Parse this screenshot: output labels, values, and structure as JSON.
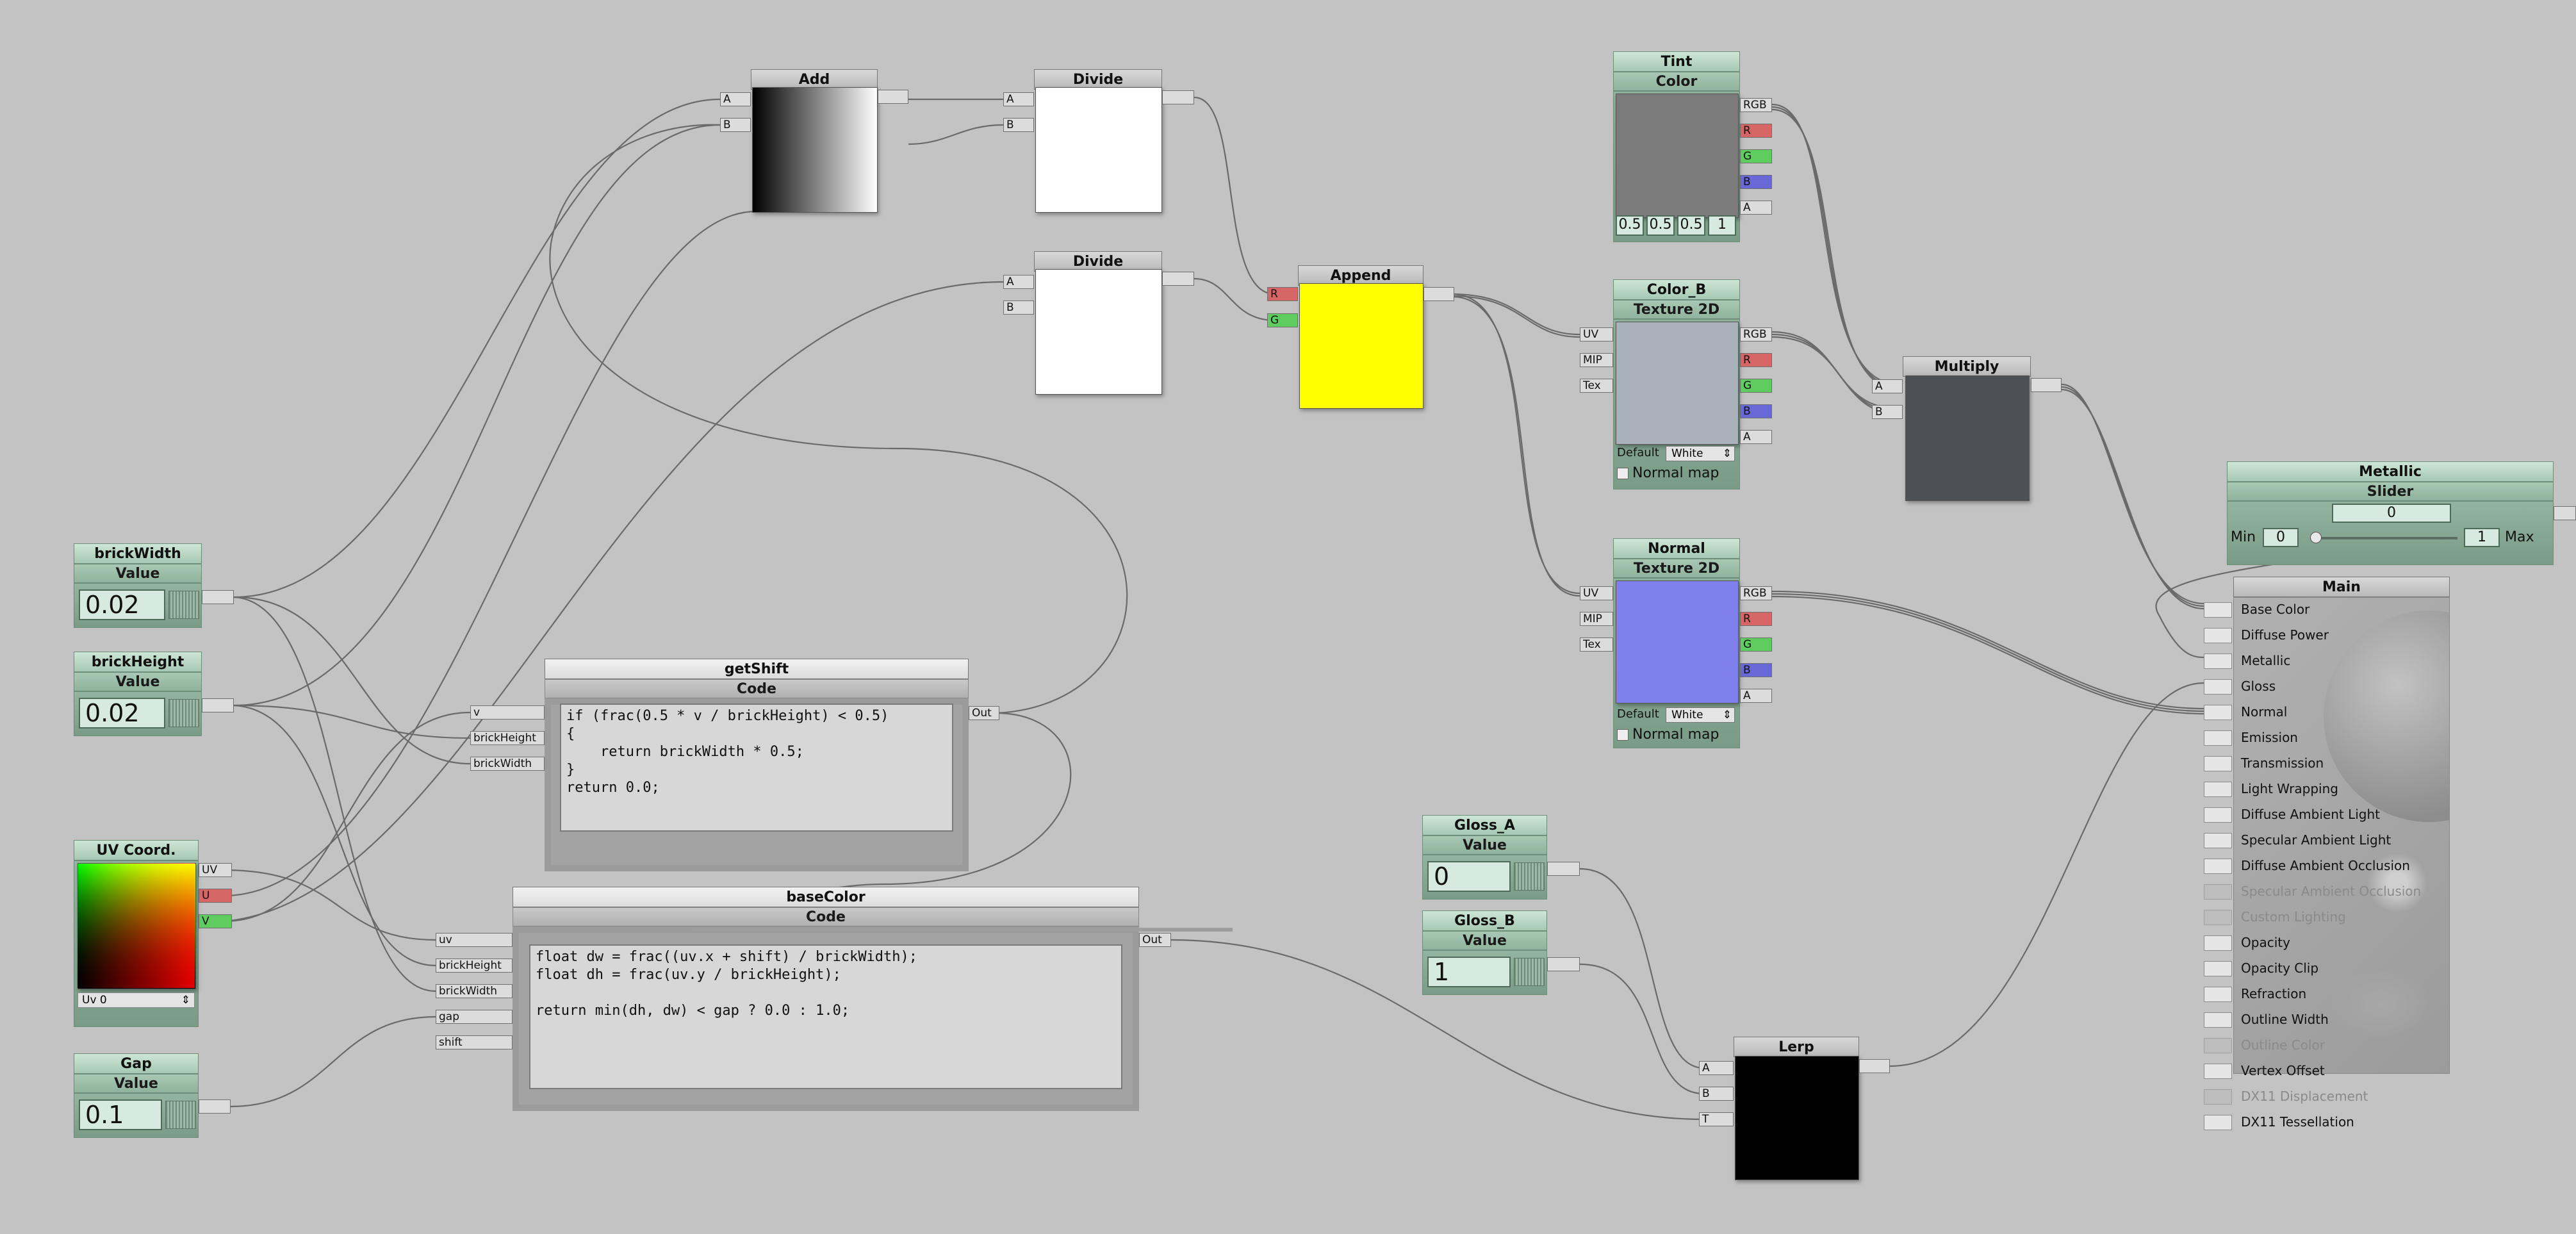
{
  "nodes": {
    "brickWidth": {
      "title": "brickWidth",
      "sub": "Value",
      "value": "0.02"
    },
    "brickHeight": {
      "title": "brickHeight",
      "sub": "Value",
      "value": "0.02"
    },
    "uvcoord": {
      "title": "UV Coord.",
      "outputs": [
        "UV",
        "U",
        "V"
      ],
      "select": "Uv 0"
    },
    "gap": {
      "title": "Gap",
      "sub": "Value",
      "value": "0.1"
    },
    "add": {
      "title": "Add",
      "inputs": [
        "A",
        "B"
      ]
    },
    "divide1": {
      "title": "Divide",
      "inputs": [
        "A",
        "B"
      ]
    },
    "divide2": {
      "title": "Divide",
      "inputs": [
        "A",
        "B"
      ]
    },
    "append": {
      "title": "Append",
      "inputs": [
        "R",
        "G"
      ]
    },
    "getShift": {
      "title": "getShift",
      "sub": "Code",
      "inputs": [
        "v",
        "brickHeight",
        "brickWidth"
      ],
      "output": "Out",
      "code": "if (frac(0.5 * v / brickHeight) < 0.5)\n{\n    return brickWidth * 0.5;\n}\nreturn 0.0;"
    },
    "baseColor": {
      "title": "baseColor",
      "sub": "Code",
      "inputs": [
        "uv",
        "brickHeight",
        "brickWidth",
        "gap",
        "shift"
      ],
      "output": "Out",
      "code": "float dw = frac((uv.x + shift) / brickWidth);\nfloat dh = frac(uv.y / brickHeight);\n\nreturn min(dh, dw) < gap ? 0.0 : 1.0;"
    },
    "tint": {
      "title": "Tint",
      "sub": "Color",
      "outputs": [
        "RGB",
        "R",
        "G",
        "B",
        "A"
      ],
      "values": [
        "0.5",
        "0.5",
        "0.5",
        "1"
      ]
    },
    "colorB": {
      "title": "Color_B",
      "sub": "Texture 2D",
      "inputs": [
        "UV",
        "MIP",
        "Tex"
      ],
      "outputs": [
        "RGB",
        "R",
        "G",
        "B",
        "A"
      ],
      "default_label": "Default",
      "default_value": "White",
      "normal_map": "Normal map"
    },
    "normal": {
      "title": "Normal",
      "sub": "Texture 2D",
      "inputs": [
        "UV",
        "MIP",
        "Tex"
      ],
      "outputs": [
        "RGB",
        "R",
        "G",
        "B",
        "A"
      ],
      "default_label": "Default",
      "default_value": "White",
      "normal_map": "Normal map"
    },
    "multiply": {
      "title": "Multiply",
      "inputs": [
        "A",
        "B"
      ]
    },
    "metallic": {
      "title": "Metallic",
      "sub": "Slider",
      "value": "0",
      "min_label": "Min",
      "min": "0",
      "max": "1",
      "max_label": "Max",
      "slider_fraction": 0
    },
    "glossA": {
      "title": "Gloss_A",
      "sub": "Value",
      "value": "0"
    },
    "glossB": {
      "title": "Gloss_B",
      "sub": "Value",
      "value": "1"
    },
    "lerp": {
      "title": "Lerp",
      "inputs": [
        "A",
        "B",
        "T"
      ]
    },
    "main": {
      "title": "Main",
      "inputs": [
        {
          "label": "Base Color",
          "enabled": true
        },
        {
          "label": "Diffuse Power",
          "enabled": true
        },
        {
          "label": "Metallic",
          "enabled": true
        },
        {
          "label": "Gloss",
          "enabled": true
        },
        {
          "label": "Normal",
          "enabled": true
        },
        {
          "label": "Emission",
          "enabled": true
        },
        {
          "label": "Transmission",
          "enabled": true
        },
        {
          "label": "Light Wrapping",
          "enabled": true
        },
        {
          "label": "Diffuse Ambient Light",
          "enabled": true
        },
        {
          "label": "Specular Ambient Light",
          "enabled": true
        },
        {
          "label": "Diffuse Ambient Occlusion",
          "enabled": true
        },
        {
          "label": "Specular Ambient Occlusion",
          "enabled": false
        },
        {
          "label": "Custom Lighting",
          "enabled": false
        },
        {
          "label": "Opacity",
          "enabled": true
        },
        {
          "label": "Opacity Clip",
          "enabled": true
        },
        {
          "label": "Refraction",
          "enabled": true
        },
        {
          "label": "Outline Width",
          "enabled": true
        },
        {
          "label": "Outline Color",
          "enabled": false
        },
        {
          "label": "Vertex Offset",
          "enabled": true
        },
        {
          "label": "DX11 Displacement",
          "enabled": false
        },
        {
          "label": "DX11 Tessellation",
          "enabled": true
        }
      ]
    }
  },
  "colors": {
    "background": "#c3c3c3",
    "tint_preview": "#7b7b7b",
    "colorB_preview": "#a9b1ba",
    "normal_preview": "#8080ec",
    "append_preview": "#ffff00",
    "multiply_preview": "#4d5155",
    "lerp_preview": "#000000",
    "port_red": "#d66565",
    "port_green": "#5fcc5f",
    "port_blue": "#6868d6"
  }
}
